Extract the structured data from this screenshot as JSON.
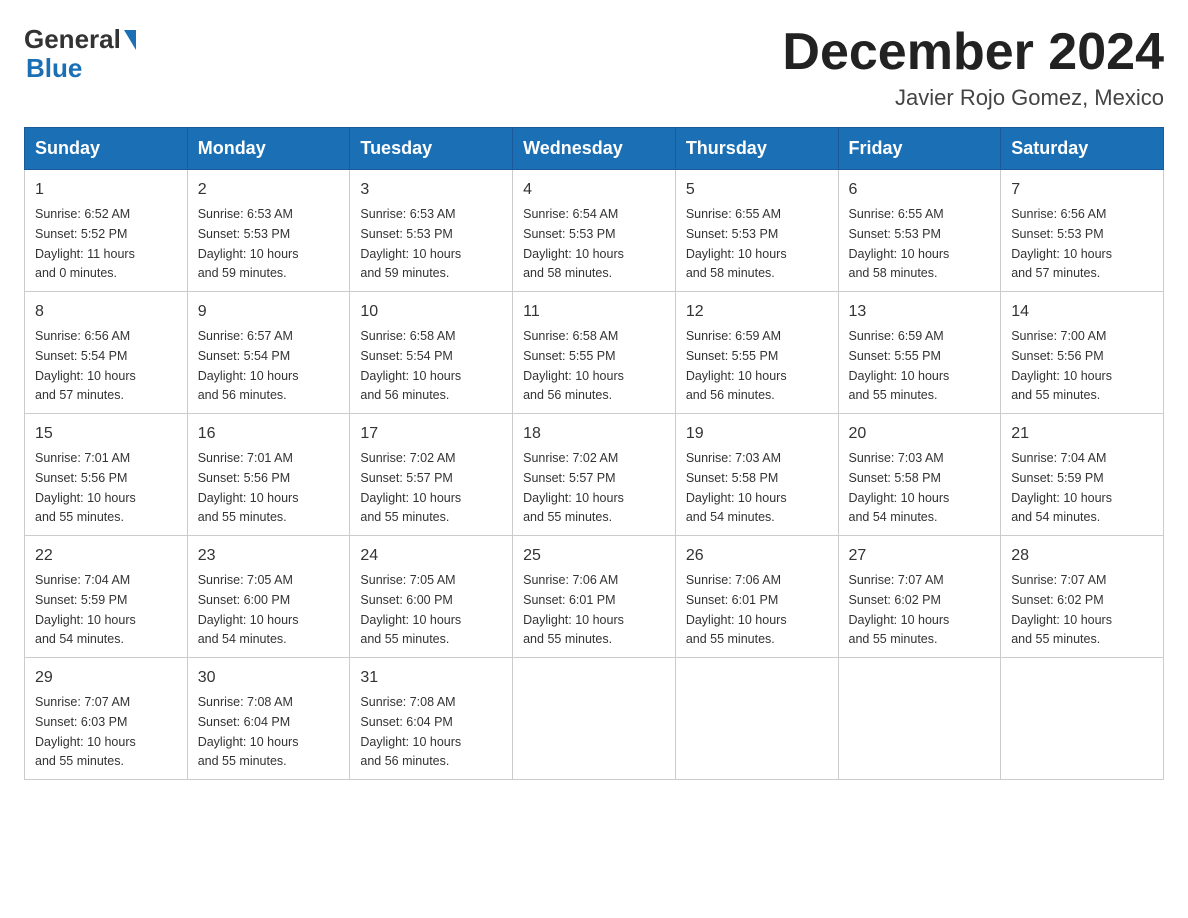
{
  "logo": {
    "general": "General",
    "blue": "Blue",
    "tagline": "Blue"
  },
  "header": {
    "month_title": "December 2024",
    "subtitle": "Javier Rojo Gomez, Mexico"
  },
  "weekdays": [
    "Sunday",
    "Monday",
    "Tuesday",
    "Wednesday",
    "Thursday",
    "Friday",
    "Saturday"
  ],
  "weeks": [
    [
      {
        "day": "1",
        "sunrise": "6:52 AM",
        "sunset": "5:52 PM",
        "daylight": "11 hours and 0 minutes."
      },
      {
        "day": "2",
        "sunrise": "6:53 AM",
        "sunset": "5:53 PM",
        "daylight": "10 hours and 59 minutes."
      },
      {
        "day": "3",
        "sunrise": "6:53 AM",
        "sunset": "5:53 PM",
        "daylight": "10 hours and 59 minutes."
      },
      {
        "day": "4",
        "sunrise": "6:54 AM",
        "sunset": "5:53 PM",
        "daylight": "10 hours and 58 minutes."
      },
      {
        "day": "5",
        "sunrise": "6:55 AM",
        "sunset": "5:53 PM",
        "daylight": "10 hours and 58 minutes."
      },
      {
        "day": "6",
        "sunrise": "6:55 AM",
        "sunset": "5:53 PM",
        "daylight": "10 hours and 58 minutes."
      },
      {
        "day": "7",
        "sunrise": "6:56 AM",
        "sunset": "5:53 PM",
        "daylight": "10 hours and 57 minutes."
      }
    ],
    [
      {
        "day": "8",
        "sunrise": "6:56 AM",
        "sunset": "5:54 PM",
        "daylight": "10 hours and 57 minutes."
      },
      {
        "day": "9",
        "sunrise": "6:57 AM",
        "sunset": "5:54 PM",
        "daylight": "10 hours and 56 minutes."
      },
      {
        "day": "10",
        "sunrise": "6:58 AM",
        "sunset": "5:54 PM",
        "daylight": "10 hours and 56 minutes."
      },
      {
        "day": "11",
        "sunrise": "6:58 AM",
        "sunset": "5:55 PM",
        "daylight": "10 hours and 56 minutes."
      },
      {
        "day": "12",
        "sunrise": "6:59 AM",
        "sunset": "5:55 PM",
        "daylight": "10 hours and 56 minutes."
      },
      {
        "day": "13",
        "sunrise": "6:59 AM",
        "sunset": "5:55 PM",
        "daylight": "10 hours and 55 minutes."
      },
      {
        "day": "14",
        "sunrise": "7:00 AM",
        "sunset": "5:56 PM",
        "daylight": "10 hours and 55 minutes."
      }
    ],
    [
      {
        "day": "15",
        "sunrise": "7:01 AM",
        "sunset": "5:56 PM",
        "daylight": "10 hours and 55 minutes."
      },
      {
        "day": "16",
        "sunrise": "7:01 AM",
        "sunset": "5:56 PM",
        "daylight": "10 hours and 55 minutes."
      },
      {
        "day": "17",
        "sunrise": "7:02 AM",
        "sunset": "5:57 PM",
        "daylight": "10 hours and 55 minutes."
      },
      {
        "day": "18",
        "sunrise": "7:02 AM",
        "sunset": "5:57 PM",
        "daylight": "10 hours and 55 minutes."
      },
      {
        "day": "19",
        "sunrise": "7:03 AM",
        "sunset": "5:58 PM",
        "daylight": "10 hours and 54 minutes."
      },
      {
        "day": "20",
        "sunrise": "7:03 AM",
        "sunset": "5:58 PM",
        "daylight": "10 hours and 54 minutes."
      },
      {
        "day": "21",
        "sunrise": "7:04 AM",
        "sunset": "5:59 PM",
        "daylight": "10 hours and 54 minutes."
      }
    ],
    [
      {
        "day": "22",
        "sunrise": "7:04 AM",
        "sunset": "5:59 PM",
        "daylight": "10 hours and 54 minutes."
      },
      {
        "day": "23",
        "sunrise": "7:05 AM",
        "sunset": "6:00 PM",
        "daylight": "10 hours and 54 minutes."
      },
      {
        "day": "24",
        "sunrise": "7:05 AM",
        "sunset": "6:00 PM",
        "daylight": "10 hours and 55 minutes."
      },
      {
        "day": "25",
        "sunrise": "7:06 AM",
        "sunset": "6:01 PM",
        "daylight": "10 hours and 55 minutes."
      },
      {
        "day": "26",
        "sunrise": "7:06 AM",
        "sunset": "6:01 PM",
        "daylight": "10 hours and 55 minutes."
      },
      {
        "day": "27",
        "sunrise": "7:07 AM",
        "sunset": "6:02 PM",
        "daylight": "10 hours and 55 minutes."
      },
      {
        "day": "28",
        "sunrise": "7:07 AM",
        "sunset": "6:02 PM",
        "daylight": "10 hours and 55 minutes."
      }
    ],
    [
      {
        "day": "29",
        "sunrise": "7:07 AM",
        "sunset": "6:03 PM",
        "daylight": "10 hours and 55 minutes."
      },
      {
        "day": "30",
        "sunrise": "7:08 AM",
        "sunset": "6:04 PM",
        "daylight": "10 hours and 55 minutes."
      },
      {
        "day": "31",
        "sunrise": "7:08 AM",
        "sunset": "6:04 PM",
        "daylight": "10 hours and 56 minutes."
      },
      null,
      null,
      null,
      null
    ]
  ]
}
